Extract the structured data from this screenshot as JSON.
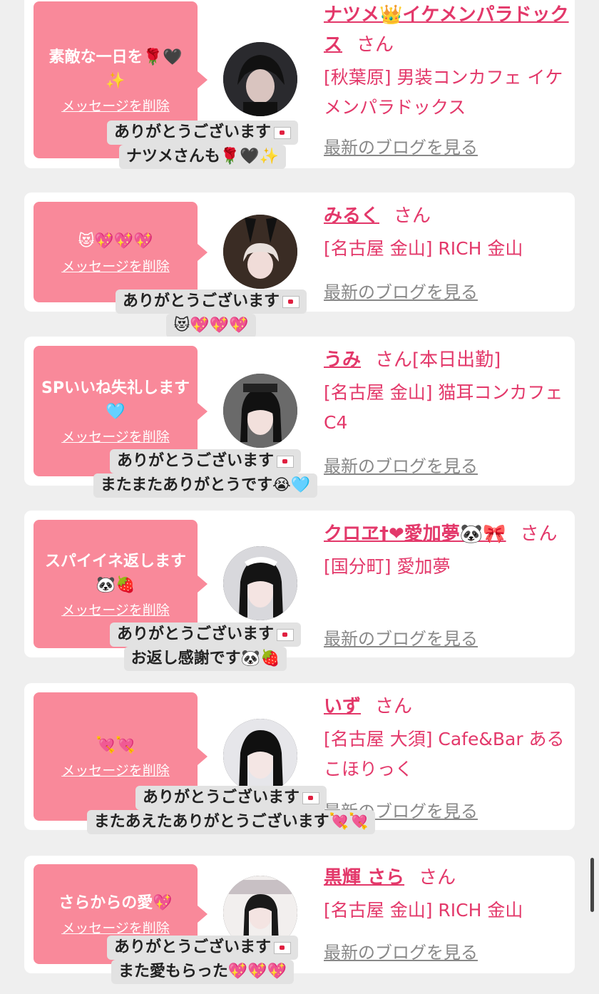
{
  "blog_label": "最新のブログを見る",
  "delete_label": "メッセージを削除",
  "san": "さん",
  "cards": [
    {
      "message": "素敵な一日を🌹🖤✨",
      "name": "ナツメ👑イケメンパラドックス",
      "status": "",
      "shop": "[秋葉原] 男装コンカフェ イケメンパラドックス",
      "reply_lines": [
        "ありがとうございます",
        "ナツメさんも🌹🖤✨"
      ]
    },
    {
      "message": "😻💖💖💖",
      "name": "みるく",
      "status": "",
      "shop": "[名古屋 金山] RICH 金山",
      "reply_lines": [
        "ありがとうございます",
        "😻💖💖💖"
      ]
    },
    {
      "message": "SPいいね失礼します🩵",
      "name": "うみ",
      "status": "[本日出勤]",
      "shop": "[名古屋 金山] 猫耳コンカフェ C4",
      "reply_lines": [
        "ありがとうございます",
        "またまたありがとうです😭🩵"
      ]
    },
    {
      "message": "スパイイネ返します🐼🍓",
      "name": "クロヱ†❤愛加夢🐼🎀",
      "status": "",
      "shop": "[国分町] 愛加夢",
      "reply_lines": [
        "ありがとうございます",
        "お返し感謝です🐼🍓"
      ]
    },
    {
      "message": "💘💘",
      "name": "いず",
      "status": "",
      "shop": "[名古屋 大須] Cafe&Bar あるこほりっく",
      "reply_lines": [
        "ありがとうございます",
        "またあえたありがとうございます💘💘"
      ]
    },
    {
      "message": "さらからの愛💖",
      "name": "黒輝 さら",
      "status": "",
      "shop": "[名古屋 金山] RICH 金山",
      "reply_lines": [
        "ありがとうございます",
        "また愛もらった💖💖💖"
      ]
    }
  ]
}
